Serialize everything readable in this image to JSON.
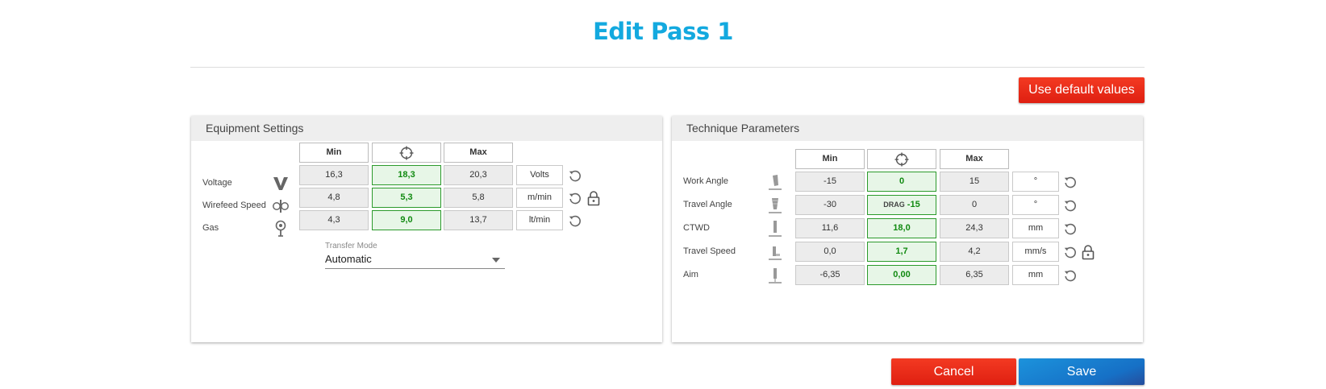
{
  "page": {
    "title": "Edit Pass 1"
  },
  "actions": {
    "default_label": "Use default values",
    "cancel_label": "Cancel",
    "save_label": "Save"
  },
  "colors": {
    "title": "#13a9df",
    "danger": "#df1f11",
    "primary": "#1670c6",
    "target_border": "#2b9a2b",
    "target_bg": "#e7f6e7"
  },
  "equipment": {
    "title": "Equipment Settings",
    "columns": {
      "min": "Min",
      "target_icon": "crosshair-icon",
      "max": "Max"
    },
    "rows": [
      {
        "label": "Voltage",
        "icon": "voltage-icon",
        "min": "16,3",
        "target": "18,3",
        "max": "20,3",
        "unit": "Volts",
        "locked": false
      },
      {
        "label": "Wirefeed Speed",
        "icon": "wirefeed-icon",
        "min": "4,8",
        "target": "5,3",
        "max": "5,8",
        "unit": "m/min",
        "locked": true
      },
      {
        "label": "Gas",
        "icon": "gas-icon",
        "min": "4,3",
        "target": "9,0",
        "max": "13,7",
        "unit": "lt/min",
        "locked": false
      }
    ],
    "transfer_mode": {
      "label": "Transfer Mode",
      "value": "Automatic"
    }
  },
  "technique": {
    "title": "Technique Parameters",
    "columns": {
      "min": "Min",
      "target_icon": "crosshair-icon",
      "max": "Max"
    },
    "rows": [
      {
        "label": "Work Angle",
        "icon": "work-angle-icon",
        "min": "-15",
        "target_prefix": "",
        "target": "0",
        "max": "15",
        "unit": "°",
        "locked": false
      },
      {
        "label": "Travel Angle",
        "icon": "travel-angle-icon",
        "min": "-30",
        "target_prefix": "DRAG",
        "target": "-15",
        "max": "0",
        "unit": "°",
        "locked": false
      },
      {
        "label": "CTWD",
        "icon": "ctwd-icon",
        "min": "11,6",
        "target_prefix": "",
        "target": "18,0",
        "max": "24,3",
        "unit": "mm",
        "locked": false
      },
      {
        "label": "Travel Speed",
        "icon": "travel-speed-icon",
        "min": "0,0",
        "target_prefix": "",
        "target": "1,7",
        "max": "4,2",
        "unit": "mm/s",
        "locked": true
      },
      {
        "label": "Aim",
        "icon": "aim-icon",
        "min": "-6,35",
        "target_prefix": "",
        "target": "0,00",
        "max": "6,35",
        "unit": "mm",
        "locked": false
      }
    ]
  }
}
